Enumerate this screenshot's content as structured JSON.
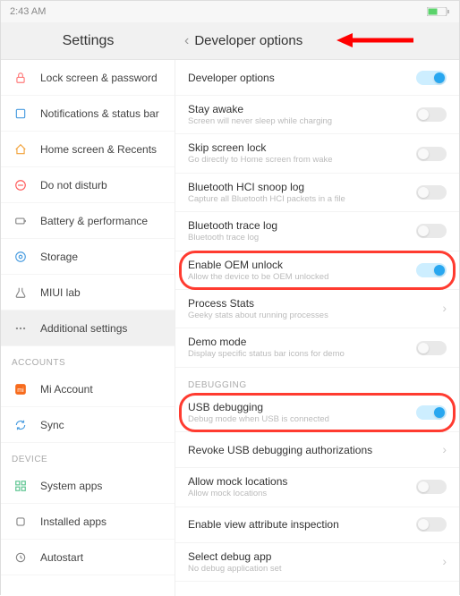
{
  "statusbar": {
    "time": "2:43 AM"
  },
  "header": {
    "settings_label": "Settings",
    "page_title": "Developer options"
  },
  "sidebar": {
    "items": [
      {
        "label": "Lock screen & password",
        "icon": "lock",
        "color": "#ff7b7b"
      },
      {
        "label": "Notifications & status bar",
        "icon": "bell",
        "color": "#4a9de0"
      },
      {
        "label": "Home screen & Recents",
        "icon": "home",
        "color": "#f2a33c"
      },
      {
        "label": "Do not disturb",
        "icon": "dnd",
        "color": "#ff5a5a"
      },
      {
        "label": "Battery & performance",
        "icon": "battery",
        "color": "#888"
      },
      {
        "label": "Storage",
        "icon": "storage",
        "color": "#4a9de0"
      },
      {
        "label": "MIUI lab",
        "icon": "lab",
        "color": "#888"
      },
      {
        "label": "Additional settings",
        "icon": "dots",
        "color": "#888",
        "active": true
      }
    ],
    "section_accounts": "ACCOUNTS",
    "accounts": [
      {
        "label": "Mi Account",
        "icon": "mi",
        "color": "#f76b1c"
      },
      {
        "label": "Sync",
        "icon": "sync",
        "color": "#4a9de0"
      }
    ],
    "section_device": "DEVICE",
    "device": [
      {
        "label": "System apps",
        "icon": "grid",
        "color": "#5bc48f"
      },
      {
        "label": "Installed apps",
        "icon": "app",
        "color": "#888"
      },
      {
        "label": "Autostart",
        "icon": "auto",
        "color": "#888"
      }
    ]
  },
  "main": {
    "rows": [
      {
        "title": "Developer options",
        "toggle": "on"
      },
      {
        "title": "Stay awake",
        "sub": "Screen will never sleep while charging",
        "toggle": "off"
      },
      {
        "title": "Skip screen lock",
        "sub": "Go directly to Home screen from wake",
        "toggle": "off"
      },
      {
        "title": "Bluetooth HCI snoop log",
        "sub": "Capture all Bluetooth HCI packets in a file",
        "toggle": "off"
      },
      {
        "title": "Bluetooth trace log",
        "sub": "Bluetooth trace log",
        "toggle": "off"
      },
      {
        "title": "Enable OEM unlock",
        "sub": "Allow the device to be OEM unlocked",
        "toggle": "on",
        "highlight": true
      },
      {
        "title": "Process Stats",
        "sub": "Geeky stats about running processes",
        "chevron": true
      },
      {
        "title": "Demo mode",
        "sub": "Display specific status bar icons for demo",
        "toggle": "off"
      }
    ],
    "section_debugging": "DEBUGGING",
    "debug_rows": [
      {
        "title": "USB debugging",
        "sub": "Debug mode when USB is connected",
        "toggle": "on",
        "highlight": true
      },
      {
        "title": "Revoke USB debugging authorizations",
        "chevron": true
      },
      {
        "title": "Allow mock locations",
        "sub": "Allow mock locations",
        "toggle": "off"
      },
      {
        "title": "Enable view attribute inspection",
        "toggle": "off"
      },
      {
        "title": "Select debug app",
        "sub": "No debug application set",
        "chevron": true
      }
    ]
  }
}
